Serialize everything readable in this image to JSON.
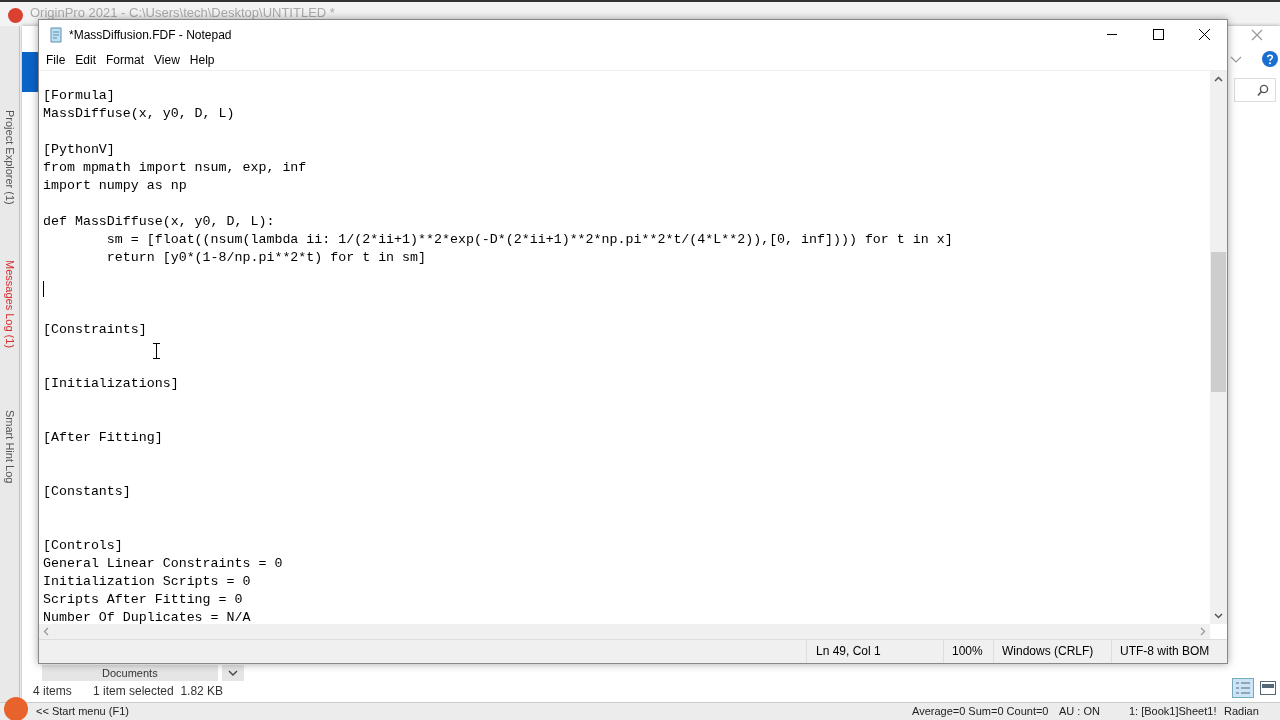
{
  "origin_window": {
    "title": "OriginPro 2021 - C:\\Users\\tech\\Desktop\\UNTITLED *",
    "side_tabs": [
      {
        "label": "Project Explorer (1)",
        "alert": false
      },
      {
        "label": "Messages Log (1)",
        "alert": true
      },
      {
        "label": "Smart Hint Log",
        "alert": false
      }
    ],
    "status_bar": {
      "start_menu": "<< Start menu (F1)",
      "stats": "Average=0 Sum=0 Count=0",
      "auto_update": "AU : ON",
      "sheet": "1: [Book1]Sheet1!",
      "angle_unit": "Radian"
    }
  },
  "explorer_window": {
    "nav_item": "Documents",
    "status": {
      "items": "4 items",
      "selection": "1 item selected  1.82 KB"
    }
  },
  "notepad": {
    "title": "*MassDiffusion.FDF - Notepad",
    "menu": [
      "File",
      "Edit",
      "Format",
      "View",
      "Help"
    ],
    "lines": [
      {
        "kind": "text",
        "text": "[Formula]"
      },
      {
        "kind": "text",
        "text": "MassDiffuse(x, y0, D, L)"
      },
      {
        "kind": "blank"
      },
      {
        "kind": "text",
        "text": "[PythonV]"
      },
      {
        "kind": "text",
        "text": "from mpmath import nsum, exp, inf"
      },
      {
        "kind": "text",
        "text": "import numpy as np"
      },
      {
        "kind": "blank"
      },
      {
        "kind": "text",
        "text": "def MassDiffuse(x, y0, D, L):"
      },
      {
        "kind": "text",
        "text": "        sm = [float((nsum(lambda ii: 1/(2*ii+1)**2*exp(-D*(2*ii+1)**2*np.pi**2*t/(4*L**2)),[0, inf]))) for t in x]"
      },
      {
        "kind": "text",
        "text": "        return [y0*(1-8/np.pi**2*t) for t in sm]"
      },
      {
        "kind": "blank"
      },
      {
        "kind": "caret"
      },
      {
        "kind": "blank"
      },
      {
        "kind": "text",
        "text": "[Constraints]"
      },
      {
        "kind": "blank"
      },
      {
        "kind": "blank"
      },
      {
        "kind": "text",
        "text": "[Initializations]"
      },
      {
        "kind": "blank"
      },
      {
        "kind": "blank"
      },
      {
        "kind": "text",
        "text": "[After Fitting]"
      },
      {
        "kind": "blank"
      },
      {
        "kind": "blank"
      },
      {
        "kind": "text",
        "text": "[Constants]"
      },
      {
        "kind": "blank"
      },
      {
        "kind": "blank"
      },
      {
        "kind": "text",
        "text": "[Controls]"
      },
      {
        "kind": "text",
        "text": "General Linear Constraints = 0"
      },
      {
        "kind": "text",
        "text": "Initialization Scripts = 0"
      },
      {
        "kind": "text",
        "text": "Scripts After Fitting = 0"
      },
      {
        "kind": "text",
        "text": "Number Of Duplicates = N/A"
      }
    ],
    "status_bar": {
      "position": "Ln 49, Col 1",
      "zoom": "100%",
      "line_ending": "Windows (CRLF)",
      "encoding": "UTF-8 with BOM"
    }
  }
}
